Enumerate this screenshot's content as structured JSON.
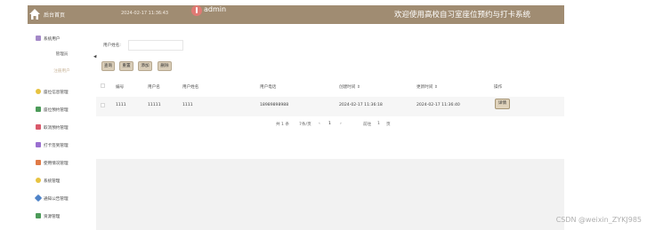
{
  "header": {
    "home_label": "后台首页",
    "time": "2024-02-17 11:36:43",
    "user": "admin",
    "system_title": "欢迎使用高校自习室座位预约与打卡系统"
  },
  "sidebar": {
    "items": [
      {
        "label": "系统用户",
        "icon": "user-group-icon",
        "color": "#a489c8"
      },
      {
        "label": "座位信息管理",
        "icon": "seat-info-icon",
        "color": "#e7c341"
      },
      {
        "label": "座位预约管理",
        "icon": "seat-reserve-icon",
        "color": "#4c9b59"
      },
      {
        "label": "取消预约管理",
        "icon": "cancel-reserve-icon",
        "color": "#d9596b"
      },
      {
        "label": "打卡签到管理",
        "icon": "checkin-icon",
        "color": "#9a6fd0"
      },
      {
        "label": "使用情况管理",
        "icon": "usage-icon",
        "color": "#e07a46"
      },
      {
        "label": "系统管理",
        "icon": "system-icon",
        "color": "#e7c341"
      },
      {
        "label": "通知公告管理",
        "icon": "notice-icon",
        "color": "#4f83c8"
      },
      {
        "label": "资源管理",
        "icon": "resource-icon",
        "color": "#4c9b59"
      }
    ],
    "subitems": [
      {
        "label": "管理员"
      },
      {
        "label": "注册用户"
      }
    ]
  },
  "search": {
    "label": "用户姓名:",
    "value": "",
    "placeholder": ""
  },
  "buttons": {
    "query": "查询",
    "reset": "重置",
    "add": "添加",
    "delete": "删除"
  },
  "table": {
    "headers": [
      "",
      "编号",
      "用户名",
      "用户姓名",
      "用户电话",
      "创建时间 ⇕",
      "更新时间 ⇕",
      "操作"
    ],
    "rows": [
      {
        "id": "1111",
        "username": "11111",
        "name": "1111",
        "phone": "18989898988",
        "created": "2024-02-17 11:36:18",
        "updated": "2024-02-17 11:36:40",
        "action": "详情"
      }
    ]
  },
  "pagination": {
    "total": "共 1 条",
    "size": "7条/页",
    "prev": "‹",
    "page": "1",
    "next": "›",
    "goto": "前往",
    "goto_page": "1",
    "page_unit": "页"
  },
  "watermark": "CSDN @weixin_ZYKJ985"
}
